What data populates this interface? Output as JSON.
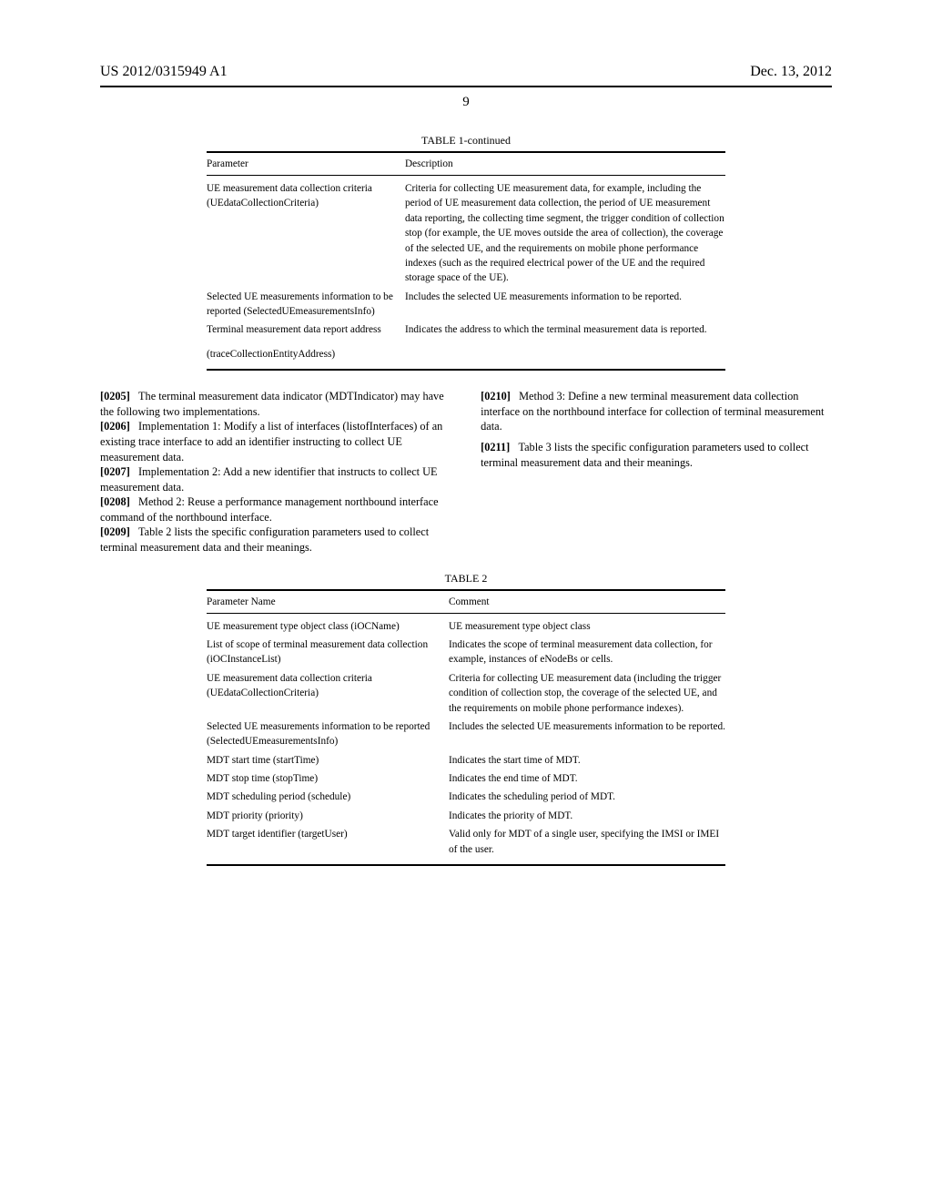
{
  "header": {
    "pub_no": "US 2012/0315949 A1",
    "date": "Dec. 13, 2012",
    "page_num": "9"
  },
  "table1": {
    "title": "TABLE 1-continued",
    "head_param": "Parameter",
    "head_desc": "Description",
    "rows": [
      {
        "param": "UE measurement data collection criteria (UEdataCollectionCriteria)",
        "desc": "Criteria for collecting UE measurement data, for example, including the period of UE measurement data collection, the period of UE measurement data reporting, the collecting time segment, the trigger condition of collection stop (for example, the UE moves outside the area of collection), the coverage of the selected UE, and the requirements on mobile phone performance indexes (such as the required electrical power of the UE and the required storage space of the UE)."
      },
      {
        "param": "Selected UE measurements information to be reported (SelectedUEmeasurementsInfo)",
        "desc": "Includes the selected UE measurements information to be reported."
      },
      {
        "param": "Terminal measurement data report address",
        "desc": "Indicates the address to which the terminal measurement data is reported."
      },
      {
        "param": "(traceCollectionEntityAddress)",
        "desc": ""
      }
    ]
  },
  "paragraphs": {
    "p0205": "The terminal measurement data indicator (MDTIndicator) may have the following two implementations.",
    "p0206": "Implementation 1: Modify a list of interfaces (listofInterfaces) of an existing trace interface to add an identifier instructing to collect UE measurement data.",
    "p0207": "Implementation 2: Add a new identifier that instructs to collect UE measurement data.",
    "p0208": "Method 2: Reuse a performance management northbound interface command of the northbound interface.",
    "p0209": "Table 2 lists the specific configuration parameters used to collect terminal measurement data and their meanings.",
    "p0210": "Method 3: Define a new terminal measurement data collection interface on the northbound interface for collection of terminal measurement data.",
    "p0211": "Table 3 lists the specific configuration parameters used to collect terminal measurement data and their meanings."
  },
  "labels": {
    "n0205": "[0205]",
    "n0206": "[0206]",
    "n0207": "[0207]",
    "n0208": "[0208]",
    "n0209": "[0209]",
    "n0210": "[0210]",
    "n0211": "[0211]"
  },
  "table2": {
    "title": "TABLE 2",
    "head_param": "Parameter Name",
    "head_desc": "Comment",
    "rows": [
      {
        "param": "UE measurement type object class (iOCName)",
        "desc": "UE measurement type object class"
      },
      {
        "param": "List of scope of terminal measurement data collection (iOCInstanceList)",
        "desc": "Indicates the scope of terminal measurement data collection, for example, instances of eNodeBs or cells."
      },
      {
        "param": "UE measurement data collection criteria (UEdataCollectionCriteria)",
        "desc": "Criteria for collecting UE measurement data (including the trigger condition of collection stop, the coverage of the selected UE, and the requirements on mobile phone performance indexes)."
      },
      {
        "param": "Selected UE measurements information to be reported (SelectedUEmeasurementsInfo)",
        "desc": "Includes the selected UE measurements information to be reported."
      },
      {
        "param": "MDT start time (startTime)",
        "desc": "Indicates the start time of MDT."
      },
      {
        "param": "MDT stop time (stopTime)",
        "desc": "Indicates the end time of MDT."
      },
      {
        "param": "MDT scheduling period (schedule)",
        "desc": "Indicates the scheduling period of MDT."
      },
      {
        "param": "MDT priority (priority)",
        "desc": "Indicates the priority of MDT."
      },
      {
        "param": "MDT target identifier (targetUser)",
        "desc": "Valid only for MDT of a single user, specifying the IMSI or IMEI of the user."
      }
    ]
  }
}
